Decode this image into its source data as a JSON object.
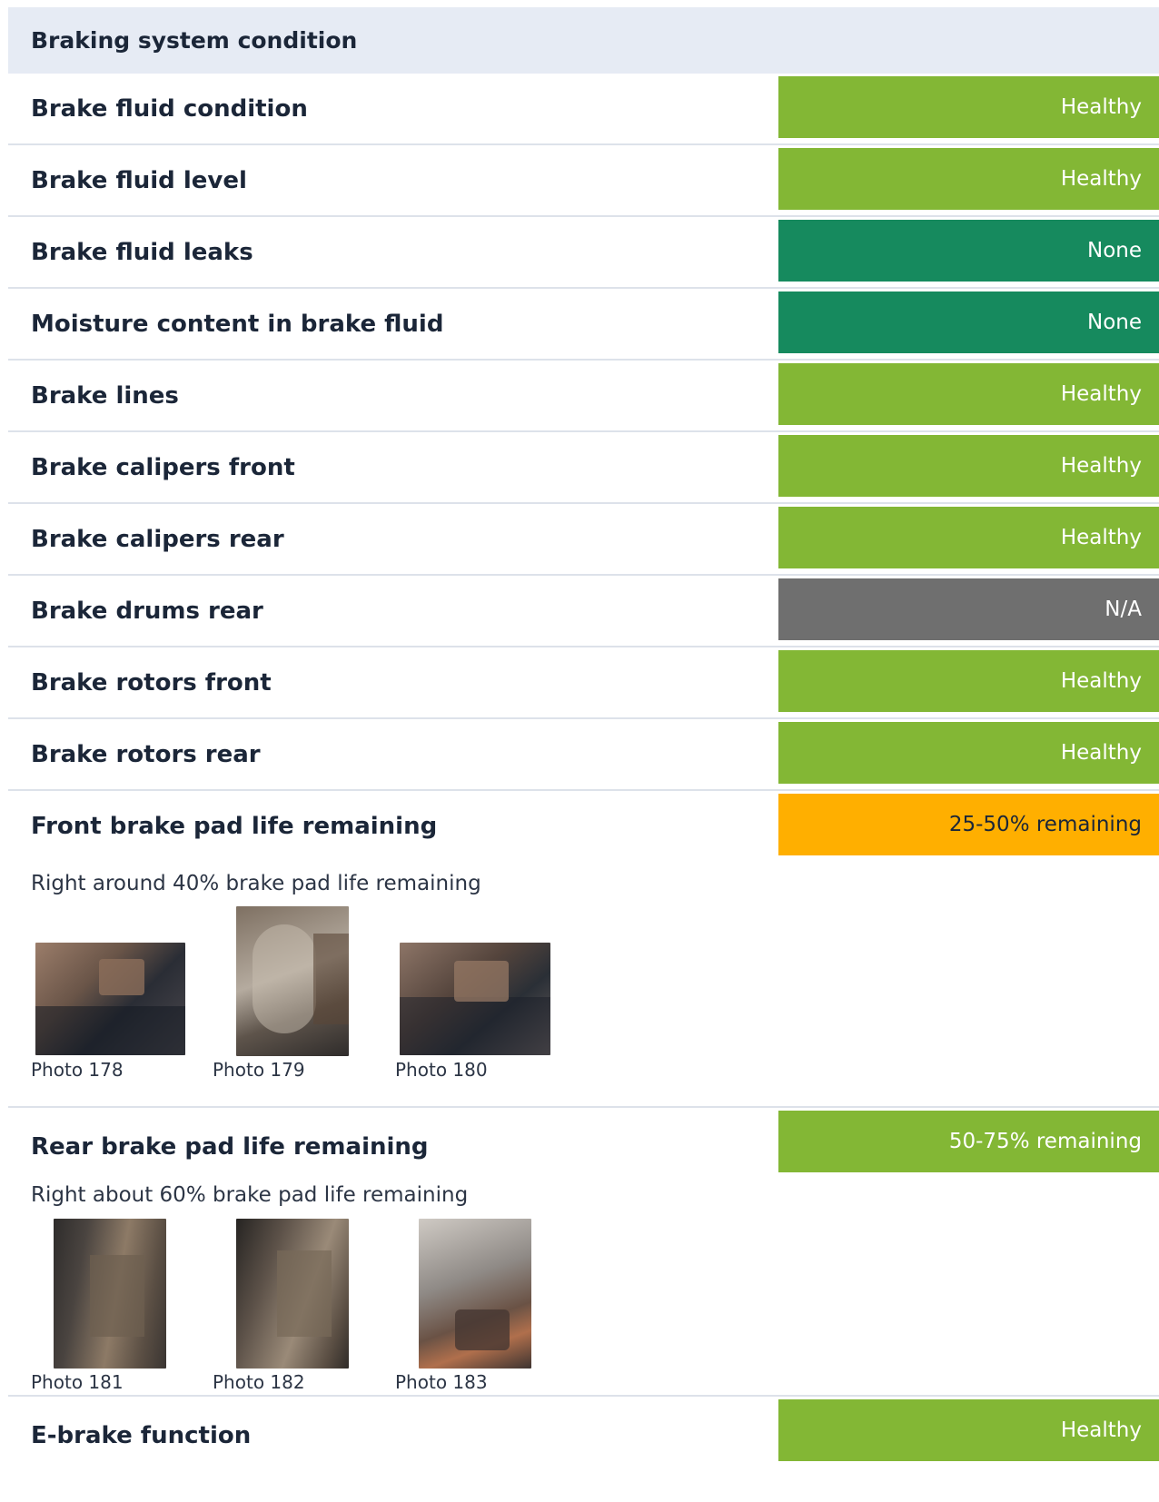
{
  "section": {
    "title": "Braking system condition"
  },
  "colors": {
    "healthy": "#83b735",
    "none": "#168a5e",
    "na": "#6f6f6f",
    "warning": "#ffaf00",
    "header_bg": "#e6ebf4"
  },
  "rows": [
    {
      "label": "Brake fluid condition",
      "status": "Healthy",
      "kind": "healthy"
    },
    {
      "label": "Brake fluid level",
      "status": "Healthy",
      "kind": "healthy"
    },
    {
      "label": "Brake fluid leaks",
      "status": "None",
      "kind": "none"
    },
    {
      "label": "Moisture content in brake fluid",
      "status": "None",
      "kind": "none"
    },
    {
      "label": "Brake lines",
      "status": "Healthy",
      "kind": "healthy"
    },
    {
      "label": "Brake calipers front",
      "status": "Healthy",
      "kind": "healthy"
    },
    {
      "label": "Brake calipers rear",
      "status": "Healthy",
      "kind": "healthy"
    },
    {
      "label": "Brake drums rear",
      "status": "N/A",
      "kind": "na"
    },
    {
      "label": "Brake rotors front",
      "status": "Healthy",
      "kind": "healthy"
    },
    {
      "label": "Brake rotors rear",
      "status": "Healthy",
      "kind": "healthy"
    }
  ],
  "front_pads": {
    "label": "Front brake pad life remaining",
    "status": "25-50% remaining",
    "note": "Right around 40% brake pad life remaining",
    "photos": [
      "Photo 178",
      "Photo 179",
      "Photo 180"
    ]
  },
  "rear_pads": {
    "label": "Rear brake pad life remaining",
    "status": "50-75% remaining",
    "note": "Right about 60% brake pad life remaining",
    "photos": [
      "Photo 181",
      "Photo 182",
      "Photo 183"
    ]
  },
  "ebrake": {
    "label": "E-brake function",
    "status": "Healthy"
  }
}
